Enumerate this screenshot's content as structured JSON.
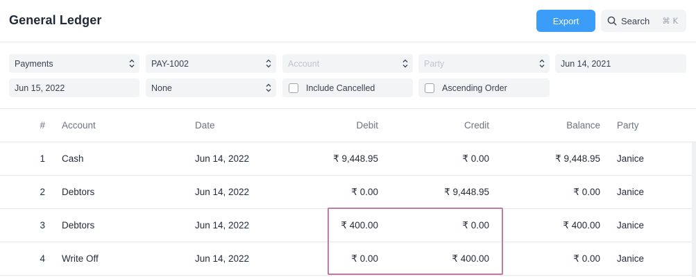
{
  "header": {
    "title": "General Ledger",
    "export_label": "Export",
    "search_label": "Search",
    "search_shortcut": "⌘ K"
  },
  "filters": {
    "ref_type": "Payments",
    "ref_name": "PAY-1002",
    "account_placeholder": "Account",
    "party_placeholder": "Party",
    "from_date": "Jun 14, 2021",
    "to_date": "Jun 15, 2022",
    "group_by": "None",
    "include_cancelled_label": "Include Cancelled",
    "ascending_order_label": "Ascending Order"
  },
  "table": {
    "columns": [
      "#",
      "Account",
      "Date",
      "Debit",
      "Credit",
      "Balance",
      "Party"
    ],
    "rows": [
      {
        "num": "1",
        "account": "Cash",
        "date": "Jun 14, 2022",
        "debit": "₹ 9,448.95",
        "credit": "₹ 0.00",
        "balance": "₹ 9,448.95",
        "party": "Janice"
      },
      {
        "num": "2",
        "account": "Debtors",
        "date": "Jun 14, 2022",
        "debit": "₹ 0.00",
        "credit": "₹ 9,448.95",
        "balance": "₹ 0.00",
        "party": "Janice"
      },
      {
        "num": "3",
        "account": "Debtors",
        "date": "Jun 14, 2022",
        "debit": "₹ 400.00",
        "credit": "₹ 0.00",
        "balance": "₹ 400.00",
        "party": "Janice"
      },
      {
        "num": "4",
        "account": "Write Off",
        "date": "Jun 14, 2022",
        "debit": "₹ 0.00",
        "credit": "₹ 400.00",
        "balance": "₹ 0.00",
        "party": "Janice"
      }
    ]
  },
  "colors": {
    "accent": "#3b9df8",
    "highlight": "#c07aa3"
  }
}
